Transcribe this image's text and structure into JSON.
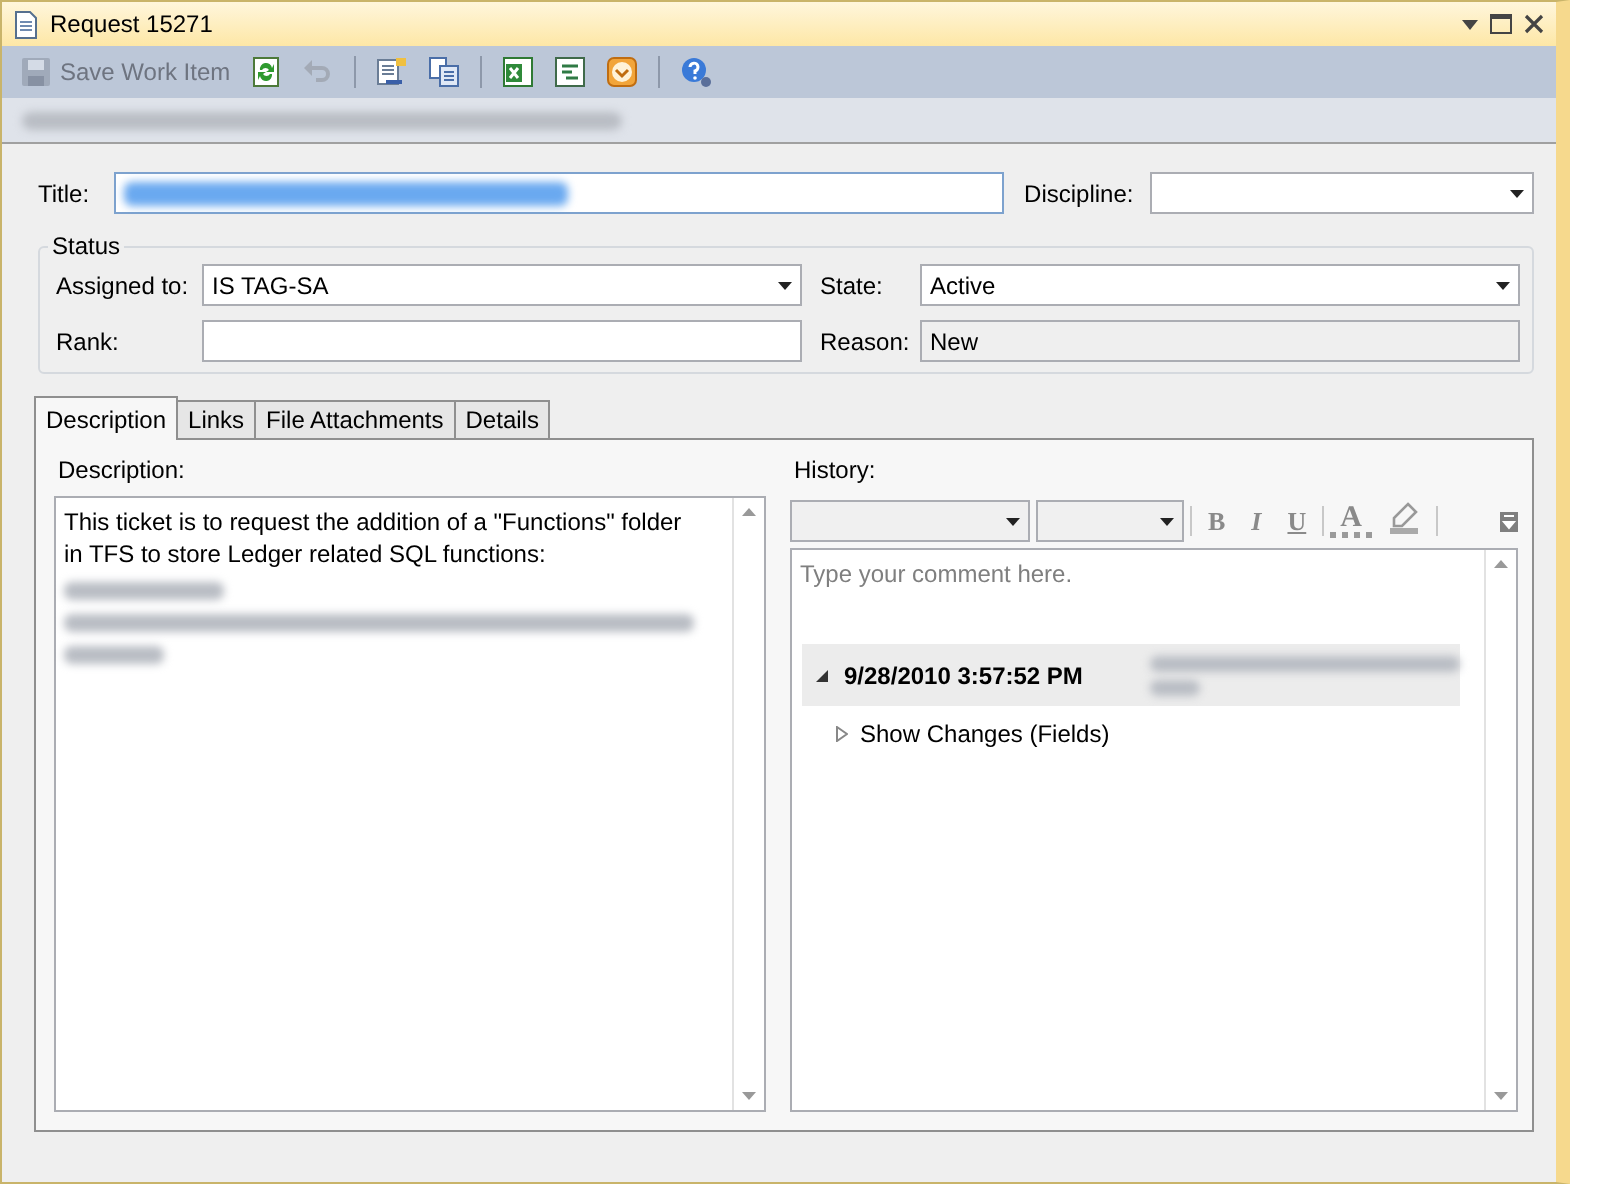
{
  "window": {
    "title": "Request 15271"
  },
  "toolbar": {
    "groups": [
      [
        {
          "kind": "save",
          "label": "Save Work Item",
          "disabled": true
        },
        {
          "kind": "refresh",
          "disabled": false
        },
        {
          "kind": "undo",
          "disabled": true
        }
      ],
      [
        {
          "kind": "links",
          "disabled": false
        },
        {
          "kind": "copy",
          "disabled": false
        }
      ],
      [
        {
          "kind": "excel",
          "disabled": false
        },
        {
          "kind": "project",
          "disabled": false
        },
        {
          "kind": "outlook",
          "disabled": false
        }
      ],
      [
        {
          "kind": "help",
          "disabled": false
        }
      ]
    ]
  },
  "breadcrumb": {
    "redacted": true
  },
  "title_field": {
    "label": "Title:",
    "redacted": true
  },
  "discipline": {
    "label": "Discipline:"
  },
  "status": {
    "label": "Status",
    "fields": [
      {
        "label": "Assigned to:",
        "kind": "combo",
        "value": "IS TAG-SA",
        "disabled": false
      },
      {
        "label": "State:",
        "kind": "combo",
        "value": "Active",
        "disabled": false
      },
      {
        "label": "Rank:",
        "kind": "text",
        "disabled": false
      },
      {
        "label": "Reason:",
        "kind": "text",
        "value": "New",
        "disabled": true
      }
    ]
  },
  "tabs": [
    {
      "label": "Description",
      "selected": true
    },
    {
      "label": "Links",
      "selected": false
    },
    {
      "label": "File Attachments",
      "selected": false
    },
    {
      "label": "Details",
      "selected": false
    }
  ],
  "description": {
    "label": "Description:",
    "text": "This ticket is to request the addition of a \"Functions\" folder in TFS to store Ledger related SQL functions:",
    "redacted": true
  },
  "history": {
    "label": "History:",
    "format_buttons": [
      {
        "kind": "bold",
        "label": "B"
      },
      {
        "kind": "italic",
        "label": "I"
      },
      {
        "kind": "underline",
        "label": "U"
      },
      {
        "kind": "color",
        "label": "A"
      },
      {
        "kind": "highlight"
      }
    ],
    "placeholder": "Type your comment here.",
    "entries": [
      {
        "date": "9/28/2010 3:57:52 PM",
        "expanded": true,
        "author_redacted": true,
        "children": [
          {
            "label": "Show Changes (Fields)",
            "expanded": false
          }
        ]
      }
    ]
  }
}
